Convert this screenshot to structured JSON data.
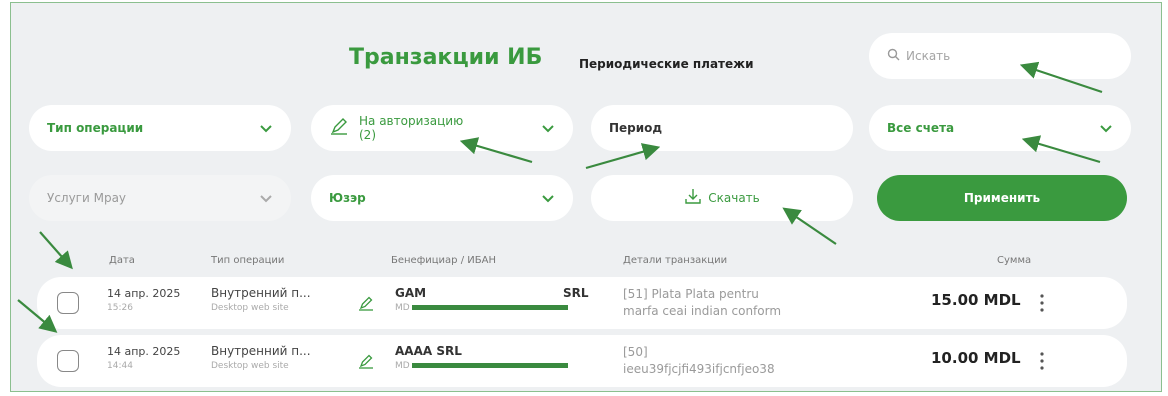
{
  "colors": {
    "accent": "#3a9a3f",
    "background": "#eef0f2",
    "annotation_arrow": "#3a8a3f"
  },
  "tabs": {
    "active": "Транзакции ИБ",
    "periodic": "Периодические платежи"
  },
  "search": {
    "placeholder": "Искать",
    "icon": "search-icon"
  },
  "filters": {
    "operation_type": "Тип операции",
    "authorization": "На авторизацию",
    "authorization_count": "(2)",
    "period": "Период",
    "accounts": "Все счета",
    "services": "Услуги Mpay",
    "user": "Юзэр",
    "download": "Скачать",
    "apply": "Применить"
  },
  "table": {
    "headers": [
      "Дата",
      "Тип операции",
      "Бенефициар / ИБАН",
      "Детали транзакции",
      "Сумма"
    ],
    "rows": [
      {
        "date": "14 апр. 2025",
        "time": "15:26",
        "type": "Внутренний п...",
        "channel": "Desktop web site",
        "beneficiary": "GAM",
        "beneficiary_suffix": "SRL",
        "iban_prefix": "MD",
        "details_line1": "[51] Plata Plata pentru",
        "details_line2": "marfa ceai indian conform",
        "amount": "15.00 MDL"
      },
      {
        "date": "14 апр. 2025",
        "time": "14:44",
        "type": "Внутренний п...",
        "channel": "Desktop web site",
        "beneficiary": "AAAA SRL",
        "beneficiary_suffix": "",
        "iban_prefix": "MD",
        "details_line1": "[50]",
        "details_line2": "ieeu39fjcjfi493ifjcnfjeo38",
        "amount": "10.00 MDL"
      }
    ]
  }
}
